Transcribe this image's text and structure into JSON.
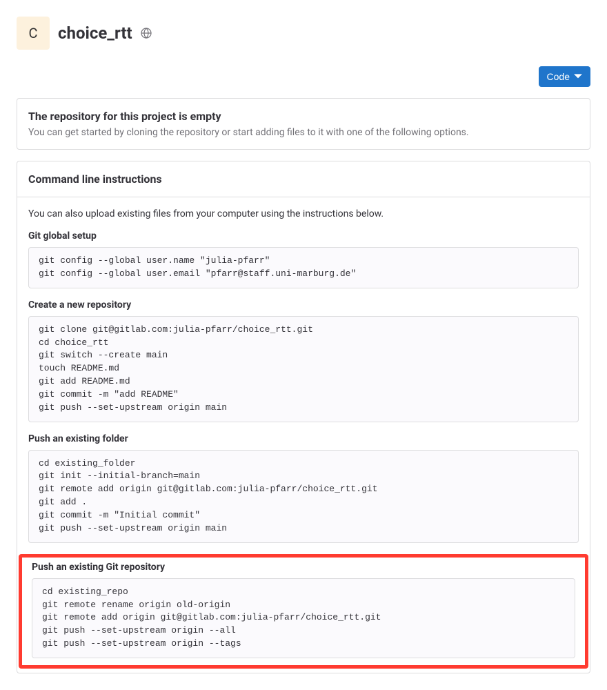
{
  "header": {
    "avatar_letter": "C",
    "repo_name": "choice_rtt"
  },
  "actions": {
    "code_button_label": "Code"
  },
  "empty_panel": {
    "title": "The repository for this project is empty",
    "text": "You can get started by cloning the repository or start adding files to it with one of the following options."
  },
  "instructions": {
    "header": "Command line instructions",
    "intro": "You can also upload existing files from your computer using the instructions below.",
    "sections": [
      {
        "title": "Git global setup",
        "code": "git config --global user.name \"julia-pfarr\"\ngit config --global user.email \"pfarr@staff.uni-marburg.de\""
      },
      {
        "title": "Create a new repository",
        "code": "git clone git@gitlab.com:julia-pfarr/choice_rtt.git\ncd choice_rtt\ngit switch --create main\ntouch README.md\ngit add README.md\ngit commit -m \"add README\"\ngit push --set-upstream origin main"
      },
      {
        "title": "Push an existing folder",
        "code": "cd existing_folder\ngit init --initial-branch=main\ngit remote add origin git@gitlab.com:julia-pfarr/choice_rtt.git\ngit add .\ngit commit -m \"Initial commit\"\ngit push --set-upstream origin main"
      },
      {
        "title": "Push an existing Git repository",
        "code": "cd existing_repo\ngit remote rename origin old-origin\ngit remote add origin git@gitlab.com:julia-pfarr/choice_rtt.git\ngit push --set-upstream origin --all\ngit push --set-upstream origin --tags"
      }
    ]
  }
}
